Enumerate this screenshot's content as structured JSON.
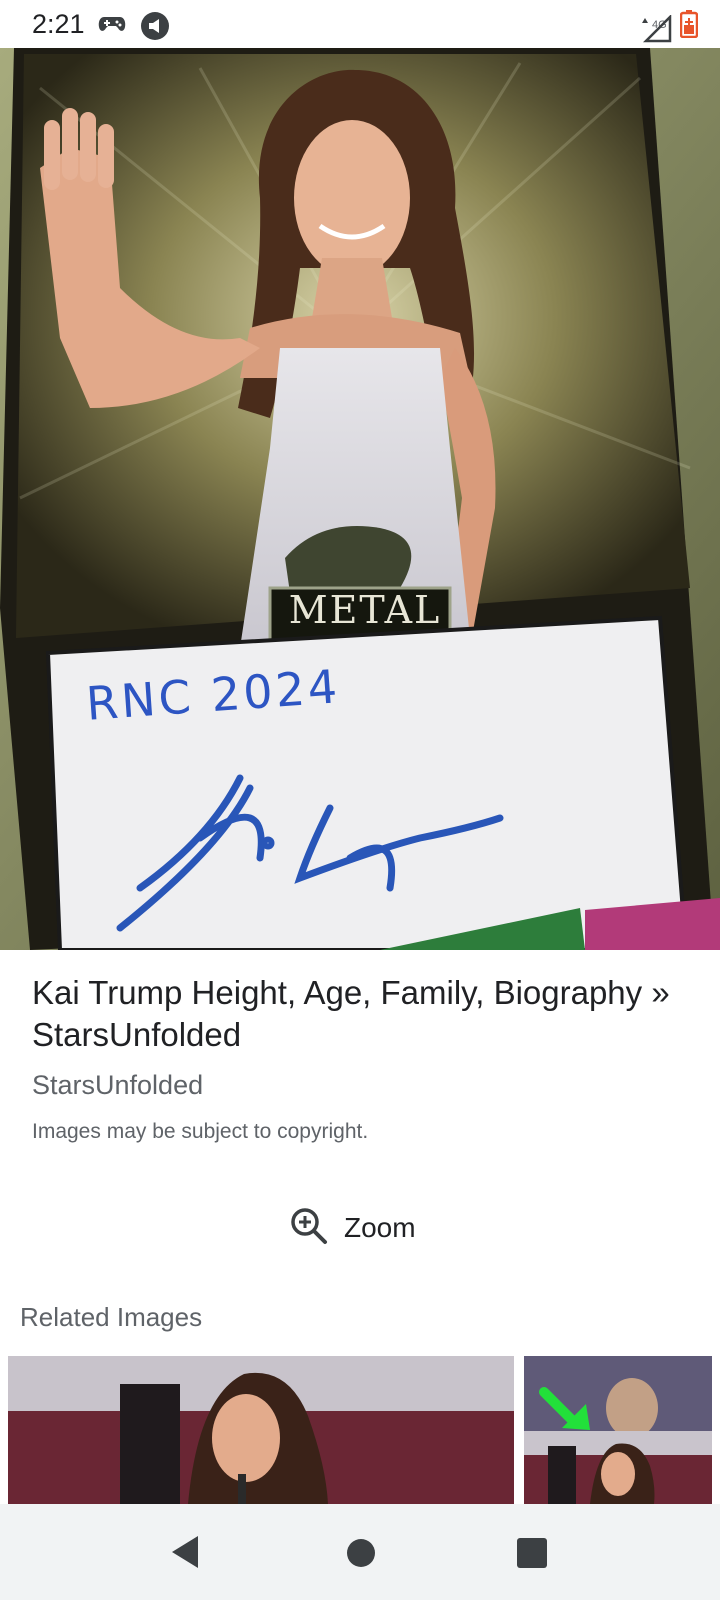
{
  "status_bar": {
    "time": "2:21",
    "network": "4G",
    "icons": [
      "game-controller-icon",
      "media-notification-icon",
      "cell-signal-icon",
      "battery-icon"
    ]
  },
  "hero_image": {
    "card_logo": "METAL",
    "card_inscription": "RNC 2024"
  },
  "result": {
    "title": "Kai Trump Height, Age, Family, Biography » StarsUnfolded",
    "source": "StarsUnfolded",
    "copyright": "Images may be subject to copyright."
  },
  "zoom": {
    "label": "Zoom",
    "icon": "zoom-in-icon"
  },
  "related": {
    "heading": "Related Images"
  },
  "nav": {
    "icons": [
      "back-icon",
      "home-icon",
      "recents-icon"
    ]
  },
  "colors": {
    "accent_green": "#22e03a",
    "nav_bg": "#f1f3f4",
    "battery": "#e8542b"
  }
}
